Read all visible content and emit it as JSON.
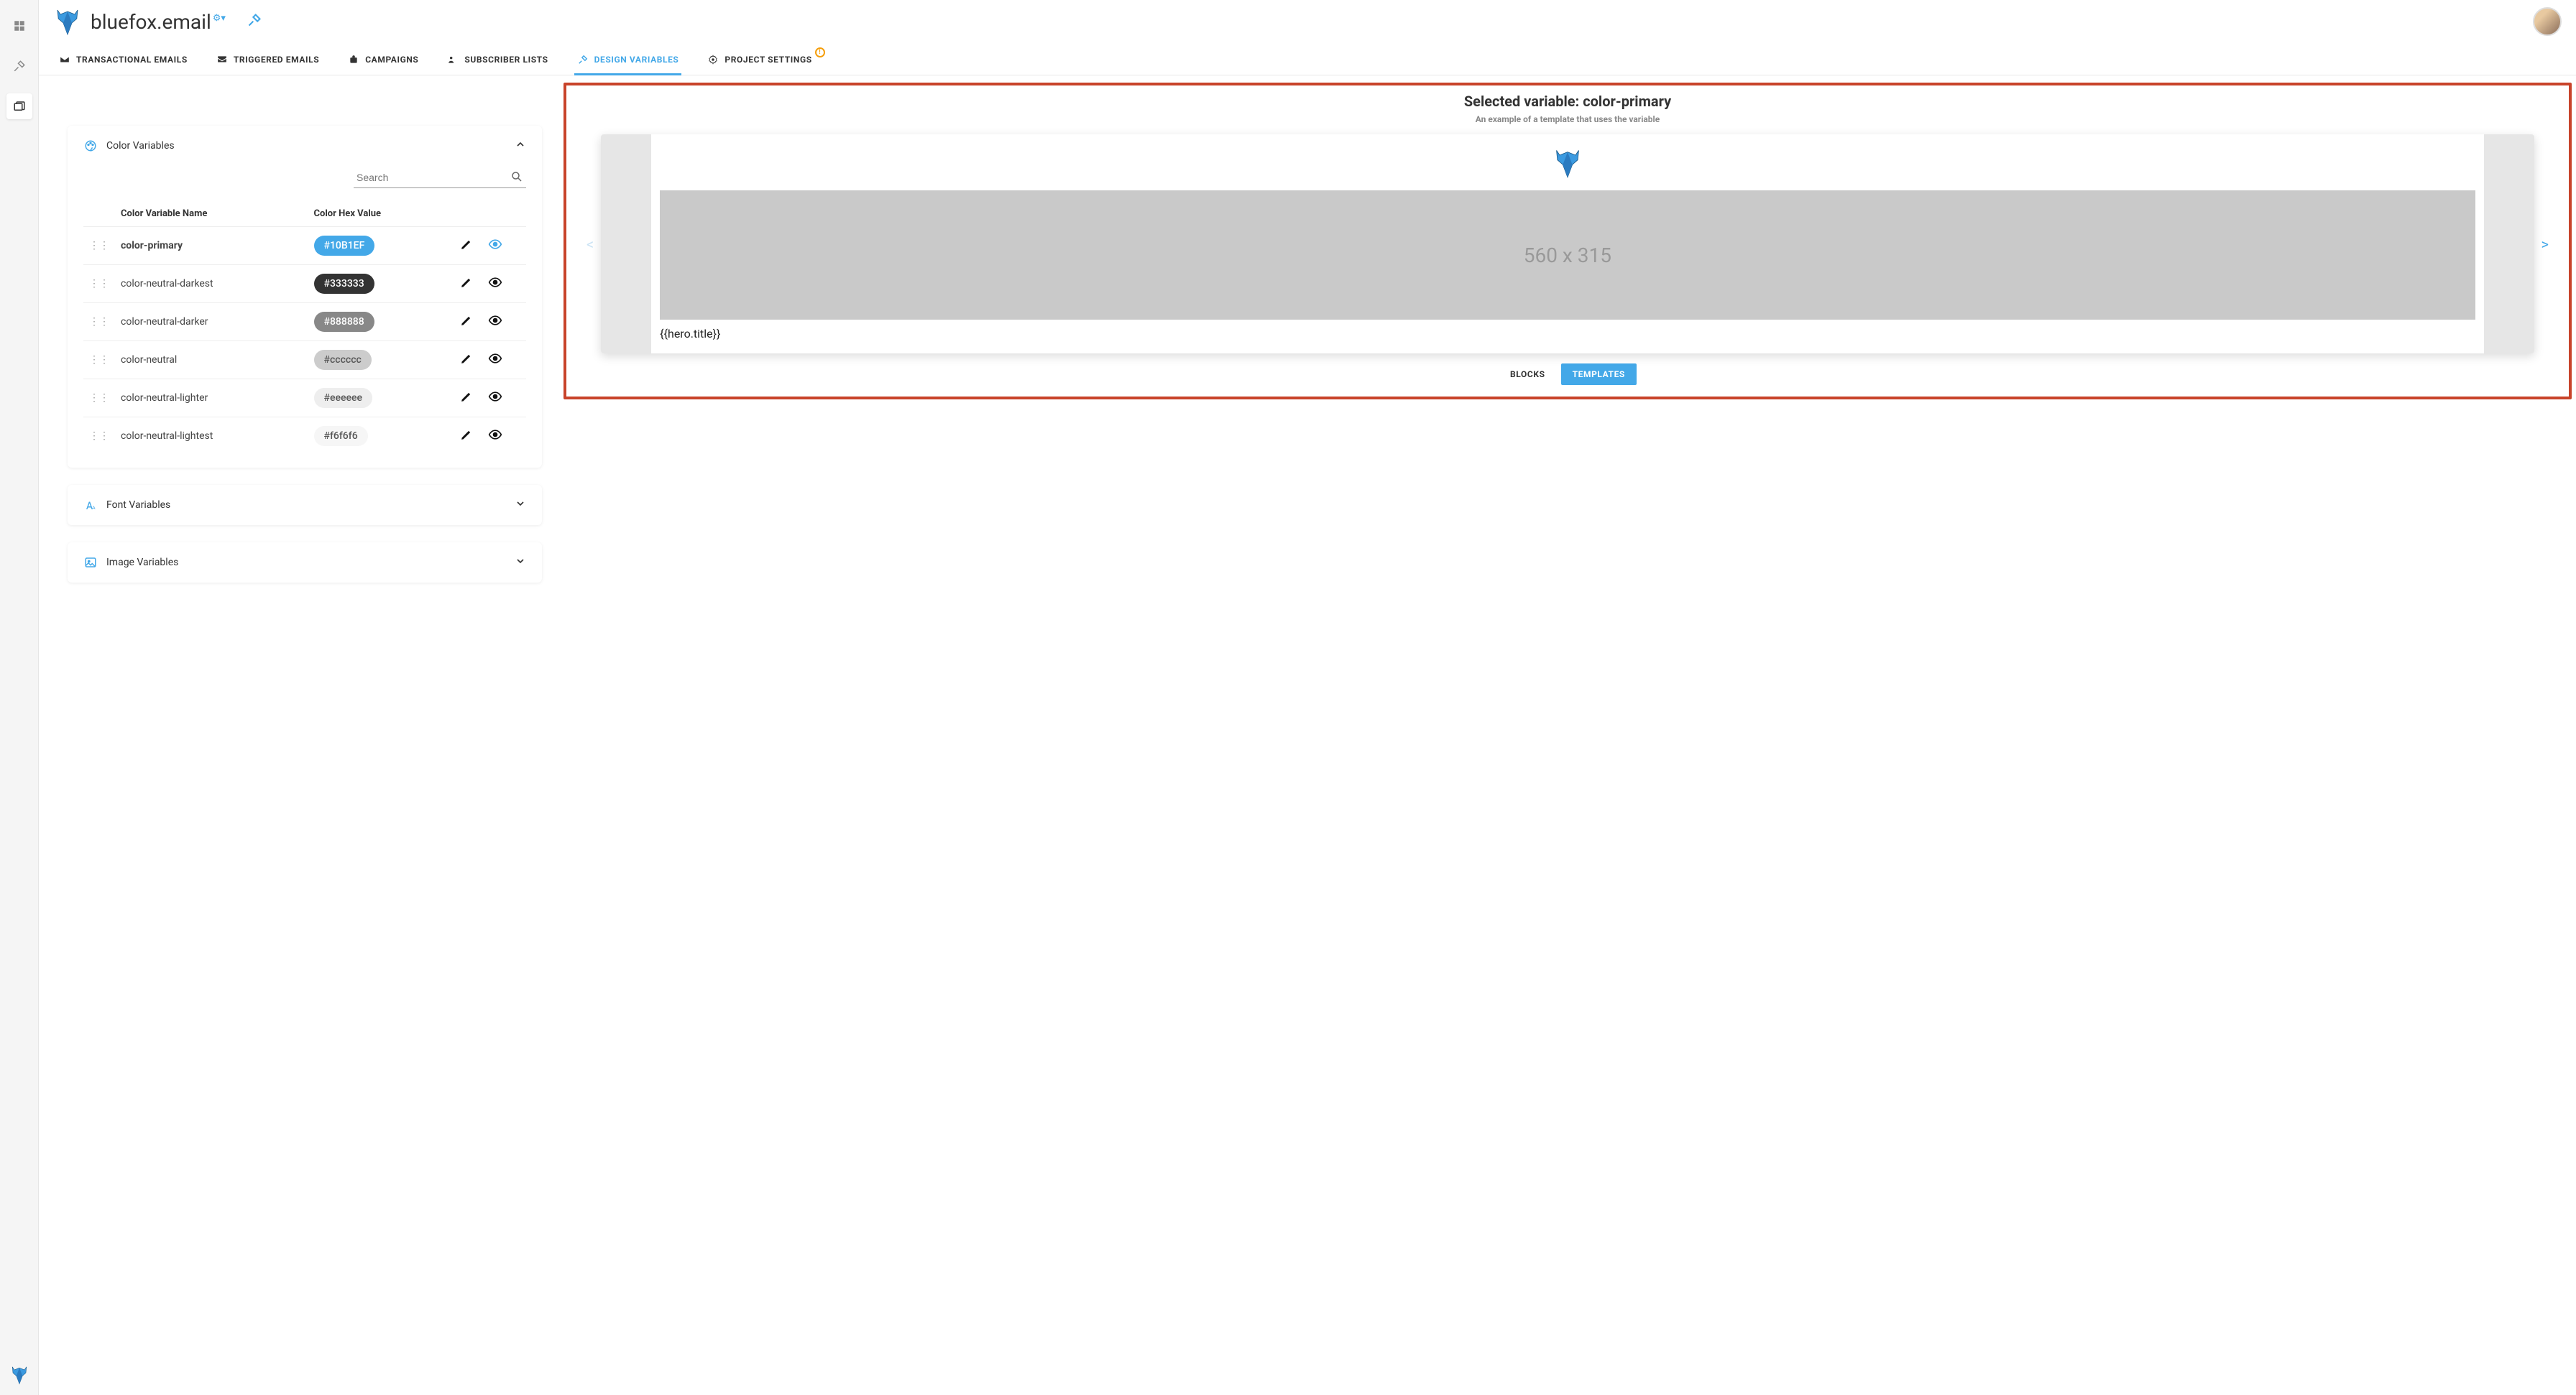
{
  "app": {
    "title": "bluefox.email",
    "badge_glyph": "⚙▾"
  },
  "nav": {
    "items": [
      {
        "icon": "envelope",
        "label": "TRANSACTIONAL EMAILS"
      },
      {
        "icon": "envelope-open",
        "label": "TRIGGERED EMAILS"
      },
      {
        "icon": "briefcase",
        "label": "CAMPAIGNS"
      },
      {
        "icon": "users",
        "label": "SUBSCRIBER LISTS"
      },
      {
        "icon": "tools",
        "label": "DESIGN VARIABLES",
        "active": true
      },
      {
        "icon": "gear",
        "label": "PROJECT SETTINGS",
        "alert": "!"
      }
    ]
  },
  "panels": {
    "colors": {
      "title": "Color Variables",
      "open": true
    },
    "fonts": {
      "title": "Font Variables",
      "open": false
    },
    "images": {
      "title": "Image Variables",
      "open": false
    }
  },
  "search": {
    "placeholder": "Search"
  },
  "table": {
    "headers": {
      "name": "Color Variable Name",
      "hex": "Color Hex Value"
    },
    "rows": [
      {
        "name": "color-primary",
        "hex": "#10B1EF",
        "bg": "#43a8e8",
        "fg": "#fff",
        "selected": true
      },
      {
        "name": "color-neutral-darkest",
        "hex": "#333333",
        "bg": "#333333",
        "fg": "#fff"
      },
      {
        "name": "color-neutral-darker",
        "hex": "#888888",
        "bg": "#888888",
        "fg": "#fff"
      },
      {
        "name": "color-neutral",
        "hex": "#cccccc",
        "bg": "#cccccc",
        "fg": "#555"
      },
      {
        "name": "color-neutral-lighter",
        "hex": "#eeeeee",
        "bg": "#eeeeee",
        "fg": "#555"
      },
      {
        "name": "color-neutral-lightest",
        "hex": "#f6f6f6",
        "bg": "#f6f6f6",
        "fg": "#555"
      }
    ]
  },
  "preview": {
    "title": "Selected variable: color-primary",
    "subtitle": "An example of a template that uses the variable",
    "placeholder_dims": "560 x 315",
    "hero_title": "{{hero.title}}",
    "tabs": {
      "blocks": "BLOCKS",
      "templates": "TEMPLATES"
    }
  }
}
